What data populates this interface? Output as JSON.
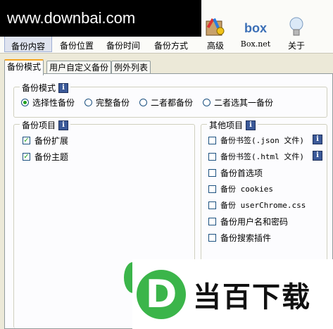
{
  "watermark": {
    "banner": "www.downbai.com",
    "logo_text": "当百下载",
    "logo_mark": "D"
  },
  "toolbar": {
    "items": [
      {
        "label": "备份内容",
        "icon": "backup-content-icon"
      },
      {
        "label": "备份位置",
        "icon": "backup-location-icon"
      },
      {
        "label": "备份时间",
        "icon": "backup-time-icon"
      },
      {
        "label": "备份方式",
        "icon": "backup-method-icon"
      },
      {
        "label": "高级",
        "icon": "advanced-tools-icon"
      },
      {
        "label": "Box.net",
        "icon": "box-net-icon",
        "icon_text": "box"
      },
      {
        "label": "关于",
        "icon": "about-lightbulb-icon"
      }
    ]
  },
  "tabs": [
    "备份模式",
    "用户自定义备份",
    "例外列表"
  ],
  "mode_group": {
    "title": "备份模式",
    "options": [
      "选择性备份",
      "完整备份",
      "二者都备份",
      "二者选其一备份"
    ],
    "selected": "选择性备份"
  },
  "items_group": {
    "title": "备份项目",
    "items": [
      {
        "label": "备份扩展",
        "checked": true
      },
      {
        "label": "备份主题",
        "checked": true
      }
    ]
  },
  "other_group": {
    "title": "其他项目",
    "items": [
      {
        "label": "备份书签(.json 文件)",
        "checked": false,
        "info": true
      },
      {
        "label": "备份书签(.html 文件)",
        "checked": false,
        "info": true
      },
      {
        "label": "备份首选项",
        "checked": false
      },
      {
        "label": "备份 cookies",
        "checked": false
      },
      {
        "label": "备份 userChrome.css",
        "checked": false
      },
      {
        "label": "备份用户名和密码",
        "checked": false
      },
      {
        "label": "备份搜索插件",
        "checked": false
      }
    ]
  },
  "colors": {
    "accent_tab": "#f5a623",
    "check_green": "#21a121",
    "info_icon": "#3b5998",
    "logo_green": "#3bb54a"
  }
}
